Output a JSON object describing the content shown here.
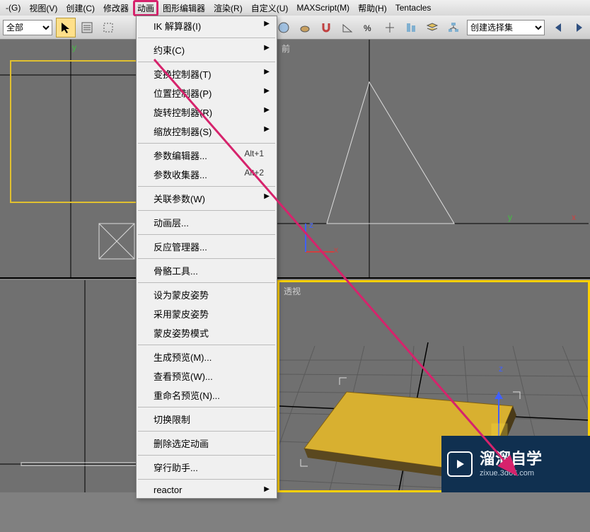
{
  "menubar": {
    "items": [
      {
        "label": "-(G)"
      },
      {
        "label": "视图(V)"
      },
      {
        "label": "创建(C)"
      },
      {
        "label": "修改器"
      },
      {
        "label": "动画",
        "highlighted": true
      },
      {
        "label": "图形编辑器"
      },
      {
        "label": "渲染(R)"
      },
      {
        "label": "自定义(U)"
      },
      {
        "label": "MAXScript(M)"
      },
      {
        "label": "帮助(H)"
      },
      {
        "label": "Tentacles"
      }
    ]
  },
  "toolbar": {
    "filter_label": "全部",
    "create_set_label": "创建选择集"
  },
  "dropdown": {
    "items": [
      {
        "type": "item",
        "label": "IK 解算器(I)",
        "arrow": true
      },
      {
        "type": "sep"
      },
      {
        "type": "item",
        "label": "约束(C)",
        "arrow": true
      },
      {
        "type": "sep"
      },
      {
        "type": "item",
        "label": "变换控制器(T)",
        "arrow": true
      },
      {
        "type": "item",
        "label": "位置控制器(P)",
        "arrow": true
      },
      {
        "type": "item",
        "label": "旋转控制器(R)",
        "arrow": true
      },
      {
        "type": "item",
        "label": "缩放控制器(S)",
        "arrow": true
      },
      {
        "type": "sep"
      },
      {
        "type": "item",
        "label": "参数编辑器...",
        "shortcut": "Alt+1"
      },
      {
        "type": "item",
        "label": "参数收集器...",
        "shortcut": "Alt+2"
      },
      {
        "type": "sep"
      },
      {
        "type": "item",
        "label": "关联参数(W)",
        "arrow": true
      },
      {
        "type": "sep"
      },
      {
        "type": "item",
        "label": "动画层..."
      },
      {
        "type": "sep"
      },
      {
        "type": "item",
        "label": "反应管理器..."
      },
      {
        "type": "sep"
      },
      {
        "type": "item",
        "label": "骨骼工具..."
      },
      {
        "type": "sep"
      },
      {
        "type": "item",
        "label": "设为蒙皮姿势"
      },
      {
        "type": "item",
        "label": "采用蒙皮姿势"
      },
      {
        "type": "item",
        "label": "蒙皮姿势模式"
      },
      {
        "type": "sep"
      },
      {
        "type": "item",
        "label": "生成预览(M)..."
      },
      {
        "type": "item",
        "label": "查看预览(W)..."
      },
      {
        "type": "item",
        "label": "重命名预览(N)..."
      },
      {
        "type": "sep"
      },
      {
        "type": "item",
        "label": "切换限制"
      },
      {
        "type": "sep"
      },
      {
        "type": "item",
        "label": "删除选定动画"
      },
      {
        "type": "sep"
      },
      {
        "type": "item",
        "label": "穿行助手..."
      },
      {
        "type": "sep"
      },
      {
        "type": "item",
        "label": "reactor",
        "arrow": true
      }
    ]
  },
  "viewports": {
    "top_left_label": "",
    "top_right_label": "前",
    "bot_left_label": "",
    "bot_right_label": "透视"
  },
  "axes": {
    "x": "x",
    "y": "y",
    "z": "z"
  },
  "watermark": {
    "main": "溜溜自学",
    "sub": "zixue.3d66.com"
  }
}
